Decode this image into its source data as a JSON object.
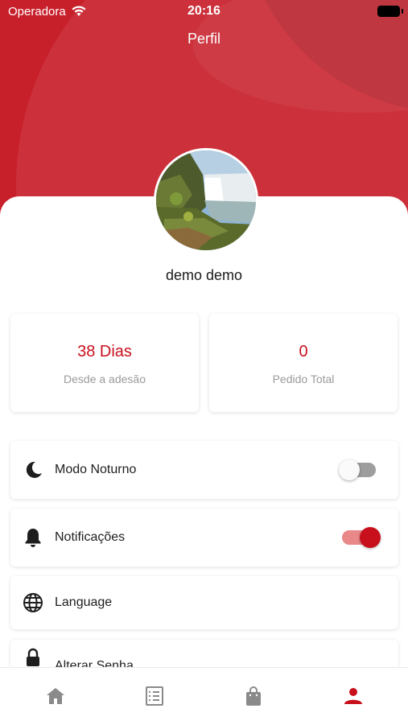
{
  "status_bar": {
    "carrier": "Operadora",
    "time": "20:16"
  },
  "header": {
    "title": "Perfil",
    "accent_color": "#c8202b"
  },
  "profile": {
    "name": "demo demo",
    "avatar": "waterfall-landscape-photo"
  },
  "stats": [
    {
      "value": "38 Dias",
      "label": "Desde a adesão"
    },
    {
      "value": "0",
      "label": "Pedido Total"
    }
  ],
  "menu": [
    {
      "label": "Modo Noturno",
      "icon": "moon-icon",
      "toggle": false
    },
    {
      "label": "Notificações",
      "icon": "bell-icon",
      "toggle": true
    },
    {
      "label": "Language",
      "icon": "globe-icon"
    },
    {
      "label": "Alterar Senha",
      "icon": "lock-icon"
    }
  ],
  "tabbar": {
    "items": [
      "home-icon",
      "list-icon",
      "shopping-bag-icon",
      "person-icon"
    ],
    "active_index": 3,
    "active_color": "#c8101d",
    "inactive_color": "#8a8a8a"
  }
}
